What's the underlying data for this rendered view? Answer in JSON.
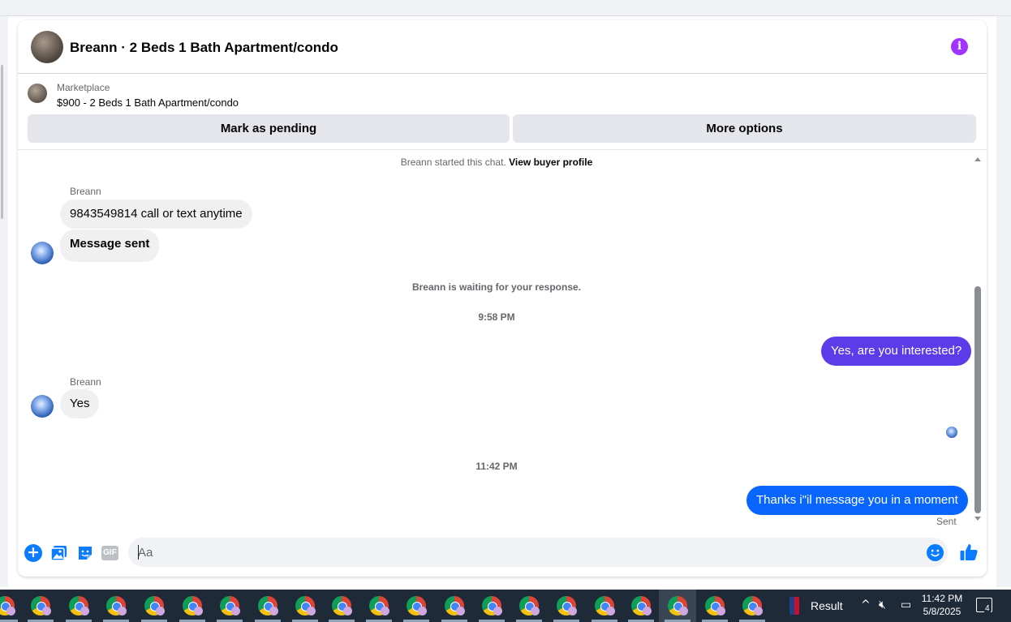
{
  "header": {
    "title": "Breann · 2 Beds 1 Bath Apartment/condo",
    "info_icon": "info-icon"
  },
  "marketplace": {
    "label": "Marketplace",
    "listing": "$900 - 2 Beds 1 Bath Apartment/condo",
    "pending_button": "Mark as pending",
    "more_button": "More options"
  },
  "chat": {
    "started_text": "Breann started this chat.",
    "view_profile": "View buyer profile",
    "sender_1": "Breann",
    "msg_1": "9843549814 call or text anytime",
    "msg_2": "Message sent",
    "waiting": "Breann is waiting for your response.",
    "time_1": "9:58 PM",
    "out_1": "Yes, are you interested?",
    "sender_2": "Breann",
    "msg_3": "Yes",
    "time_2": "11:42 PM",
    "out_2": "Thanks i\"il message you in a moment",
    "status": "Sent"
  },
  "composer": {
    "placeholder": "Aa",
    "gif_label": "GIF"
  },
  "colors": {
    "out_bubble_1": "#5c3ce8",
    "out_bubble_2": "#0866ff",
    "in_bubble": "#f0f0f0",
    "accent": "#0a7cff",
    "info_icon": "#a033ff"
  },
  "taskbar": {
    "app_icons": [
      "chrome-icon"
    ],
    "result_label": "Result",
    "clock_time": "11:42 PM",
    "clock_date": "5/8/2025",
    "notification_count": "4"
  }
}
